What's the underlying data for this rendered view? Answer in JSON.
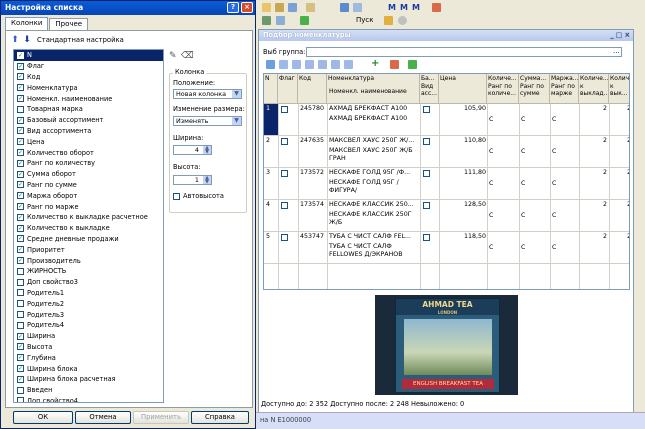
{
  "dialog": {
    "title": "Настройка списка",
    "tabs": [
      "Колонки",
      "Прочее"
    ],
    "standard_setting": "Стандартная настройка",
    "items": [
      {
        "label": "N",
        "checked": true,
        "selected": true
      },
      {
        "label": "Флаг",
        "checked": true
      },
      {
        "label": "Код",
        "checked": true
      },
      {
        "label": "Номенклатура",
        "checked": true
      },
      {
        "label": "Номенкл. наименование",
        "checked": true
      },
      {
        "label": "Товарная марка",
        "checked": false
      },
      {
        "label": "Базовый ассортимент",
        "checked": true
      },
      {
        "label": "Вид ассортимента",
        "checked": true
      },
      {
        "label": "Цена",
        "checked": true
      },
      {
        "label": "Количество оборот",
        "checked": true
      },
      {
        "label": "Ранг по количеству",
        "checked": true
      },
      {
        "label": "Сумма оборот",
        "checked": true
      },
      {
        "label": "Ранг по сумме",
        "checked": true
      },
      {
        "label": "Маржа оборот",
        "checked": true
      },
      {
        "label": "Ранг по марже",
        "checked": true
      },
      {
        "label": "Количество к выкладке расчетное",
        "checked": true
      },
      {
        "label": "Количество к выкладке",
        "checked": true
      },
      {
        "label": "Средне дневные продажи",
        "checked": true
      },
      {
        "label": "Приоритет",
        "checked": true
      },
      {
        "label": "Производитель",
        "checked": true
      },
      {
        "label": "ЖИРНОСТЬ",
        "checked": false
      },
      {
        "label": "Доп свойство3",
        "checked": false
      },
      {
        "label": "Родитель1",
        "checked": false
      },
      {
        "label": "Родитель2",
        "checked": false
      },
      {
        "label": "Родитель3",
        "checked": false
      },
      {
        "label": "Родитель4",
        "checked": false
      },
      {
        "label": "Ширина",
        "checked": true
      },
      {
        "label": "Высота",
        "checked": true
      },
      {
        "label": "Глубина",
        "checked": true
      },
      {
        "label": "Ширина блока",
        "checked": true
      },
      {
        "label": "Ширина блока расчетная",
        "checked": true
      },
      {
        "label": "Введен",
        "checked": false
      },
      {
        "label": "Доп свойство4",
        "checked": false
      }
    ],
    "column_group": "Колонка",
    "position_label": "Положение:",
    "position_value": "Новая колонка",
    "resize_label": "Изменение размера:",
    "resize_value": "Изменять",
    "width_label": "Ширина:",
    "width_value": "4",
    "height_label": "Высота:",
    "height_value": "1",
    "autoheight_label": "Автовысота",
    "buttons": {
      "ok": "ОК",
      "cancel": "Отмена",
      "apply": "Применить",
      "help": "Справка"
    }
  },
  "app": {
    "toolbar_text": "Пуск",
    "window_title": "Подбор номенклатуры",
    "group_label": "Выб группа:",
    "columns": [
      "N",
      "Флаг",
      "Код",
      "Номенклатура",
      "Ба... Вид асс...",
      "Цена",
      "Количе... Ранг по количе...",
      "Сумма... Ранг по сумме",
      "Маржа... Ранг по марже",
      "Количе... к выклад...",
      "Количе... к вык..."
    ],
    "col_sub": "Номенкл. наименование",
    "rows": [
      {
        "n": "1",
        "code": "245780",
        "name1": "АХМАД БРЕКФАСТ А100",
        "name2": "АХМАД БРЕКФАСТ А100",
        "price": "105,90",
        "c": "C",
        "v": "2"
      },
      {
        "n": "2",
        "code": "247635",
        "name1": "МАКСВЕЛ ХАУС 250Г Ж/...",
        "name2": "МАКСВЕЛ ХАУС 250Г Ж/Б ГРАН",
        "price": "110,80",
        "c": "C",
        "v": "2"
      },
      {
        "n": "3",
        "code": "173572",
        "name1": "НЕСКАФЕ ГОЛД 95Г /Ф...",
        "name2": "НЕСКАФЕ ГОЛД 95Г /ФИГУРА/",
        "price": "111,80",
        "c": "C",
        "v": "2"
      },
      {
        "n": "4",
        "code": "173574",
        "name1": "НЕСКАФЕ КЛАССИК 250...",
        "name2": "НЕСКАФЕ КЛАССИК 250Г Ж/Б",
        "price": "128,50",
        "c": "C",
        "v": "2"
      },
      {
        "n": "5",
        "code": "453747",
        "name1": "ТУБА С ЧИСТ САЛФ FEL...",
        "name2": "ТУБА С ЧИСТ САЛФ FELLOWES Д/ЭКРАНОВ",
        "price": "118,50",
        "c": "C",
        "v": "2"
      }
    ],
    "product_brand": "AHMAD TEA",
    "product_sub": "LONDON",
    "product_label": "ENGLISH BREAKFAST TEA",
    "status": "Доступно до: 2 352 Доступно после: 2 248 Невыложено: 0",
    "taskbar_item": "на N E1000000"
  },
  "colors": {
    "title_blue": "#0a5cd8",
    "selection": "#0a246a",
    "check": "#1d8a1d"
  }
}
